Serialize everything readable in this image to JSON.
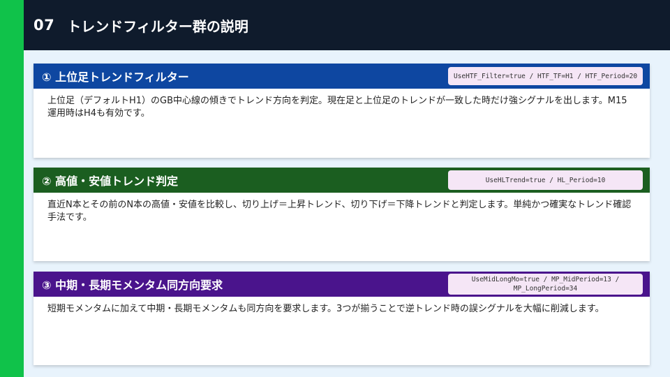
{
  "header": {
    "number": "07",
    "title": "トレンドフィルター群の説明"
  },
  "colors": {
    "left_bar": "#10c24a",
    "header_bg": "#0f1b2c",
    "page_bg": "#e8f3fc",
    "card1_head": "#0e47a1",
    "card2_head": "#1b5e20",
    "card3_head": "#4a148c",
    "param_bg": "#f5e6f6"
  },
  "cards": [
    {
      "title": "① 上位足トレンドフィルター",
      "params": "UseHTF_Filter=true / HTF_TF=H1 / HTF_Period=20",
      "description": "上位足（デフォルトH1）のGB中心線の傾きでトレンド方向を判定。現在足と上位足のトレンドが一致した時だけ強シグナルを出します。M15運用時はH4も有効です。"
    },
    {
      "title": "② 高値・安値トレンド判定",
      "params": "UseHLTrend=true / HL_Period=10",
      "description": "直近N本とその前のN本の高値・安値を比較し、切り上げ＝上昇トレンド、切り下げ＝下降トレンドと判定します。単純かつ確実なトレンド確認手法です。"
    },
    {
      "title": "③ 中期・長期モメンタム同方向要求",
      "params": "UseMidLongMo=true / MP_MidPeriod=13 / MP_LongPeriod=34",
      "description": "短期モメンタムに加えて中期・長期モメンタムも同方向を要求します。3つが揃うことで逆トレンド時の誤シグナルを大幅に削減します。"
    }
  ]
}
